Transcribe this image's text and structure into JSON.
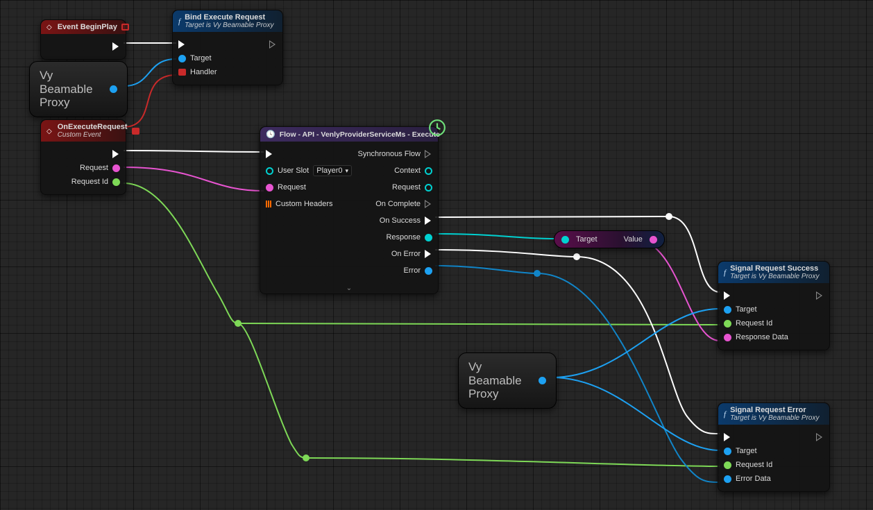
{
  "nodes": {
    "eventBeginPlay": {
      "title": "Event BeginPlay"
    },
    "bindExecuteRequest": {
      "title": "Bind Execute Request",
      "subtitle": "Target is Vy Beamable Proxy",
      "pins": {
        "target": "Target",
        "handler": "Handler"
      }
    },
    "onExecuteRequest": {
      "title": "OnExecuteRequest",
      "subtitle": "Custom Event",
      "pins": {
        "request": "Request",
        "requestId": "Request Id"
      }
    },
    "flowExecute": {
      "title": "Flow - API - VenlyProviderServiceMs - Execute",
      "pins": {
        "userSlot": "User Slot",
        "userSlotValue": "Player0",
        "request": "Request",
        "customHeaders": "Custom Headers",
        "syncFlow": "Synchronous Flow",
        "context": "Context",
        "outRequest": "Request",
        "onComplete": "On Complete",
        "onSuccess": "On Success",
        "response": "Response",
        "onError": "On Error",
        "error": "Error"
      }
    },
    "reroutePure": {
      "left": "Target",
      "right": "Value"
    },
    "signalSuccess": {
      "title": "Signal Request Success",
      "subtitle": "Target is Vy Beamable Proxy",
      "pins": {
        "target": "Target",
        "requestId": "Request Id",
        "responseData": "Response Data"
      }
    },
    "signalError": {
      "title": "Signal Request Error",
      "subtitle": "Target is Vy Beamable Proxy",
      "pins": {
        "target": "Target",
        "requestId": "Request Id",
        "errorData": "Error Data"
      }
    },
    "vyProxyVar": {
      "label": "Vy\nBeamable\nProxy"
    }
  }
}
